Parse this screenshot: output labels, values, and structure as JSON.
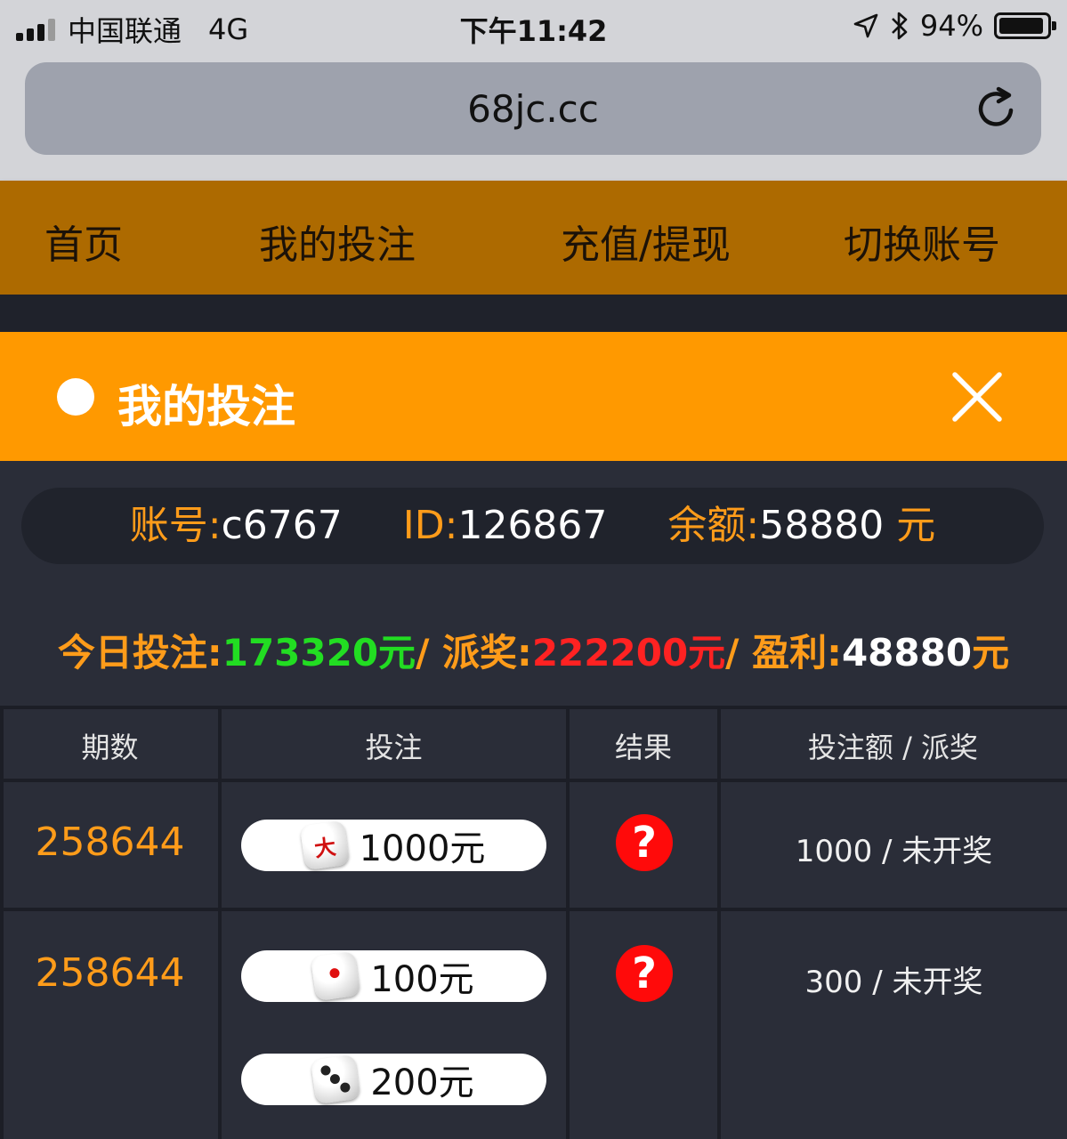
{
  "status_bar": {
    "carrier": "中国联通",
    "network": "4G",
    "time": "下午11:42",
    "battery": "94%",
    "battery_level": 0.94
  },
  "browser": {
    "url": "68jc.cc",
    "reload_icon": "reload-icon"
  },
  "nav": {
    "items": [
      {
        "label": "首页"
      },
      {
        "label": "我的投注"
      },
      {
        "label": "充值/提现"
      },
      {
        "label": "切换账号"
      }
    ]
  },
  "panel": {
    "title": "我的投注",
    "close_icon": "close-icon"
  },
  "account": {
    "account_label": "账号:",
    "account_value": "c6767",
    "id_label": "ID:",
    "id_value": "126867",
    "balance_label": "余额:",
    "balance_value": "58880",
    "balance_unit": "元"
  },
  "today": {
    "bet_label": "今日投注:",
    "bet_value": "173320元",
    "sep1": "/ ",
    "payout_label": "派奖:",
    "payout_value": "222200元",
    "sep2": "/ ",
    "profit_label": "盈利:",
    "profit_value": "48880",
    "profit_unit": "元"
  },
  "table": {
    "headers": [
      "期数",
      "投注",
      "结果",
      "投注额 / 派奖"
    ],
    "rows": [
      {
        "period": "258644",
        "bets": [
          {
            "die": "大",
            "amount": "1000元"
          }
        ],
        "result": "?",
        "summary": "1000 / 未开奖"
      },
      {
        "period": "258644",
        "bets": [
          {
            "die": "1",
            "amount": "100元"
          },
          {
            "die": "3",
            "amount": "200元"
          }
        ],
        "result": "?",
        "summary": "300 / 未开奖"
      }
    ]
  },
  "colors": {
    "nav_bg": "#ad6a00",
    "header_bg": "#ff9900",
    "label_orange": "#ff9c1a",
    "green": "#22dd22",
    "red": "#ff2222",
    "page_bg": "#2a2d38"
  }
}
